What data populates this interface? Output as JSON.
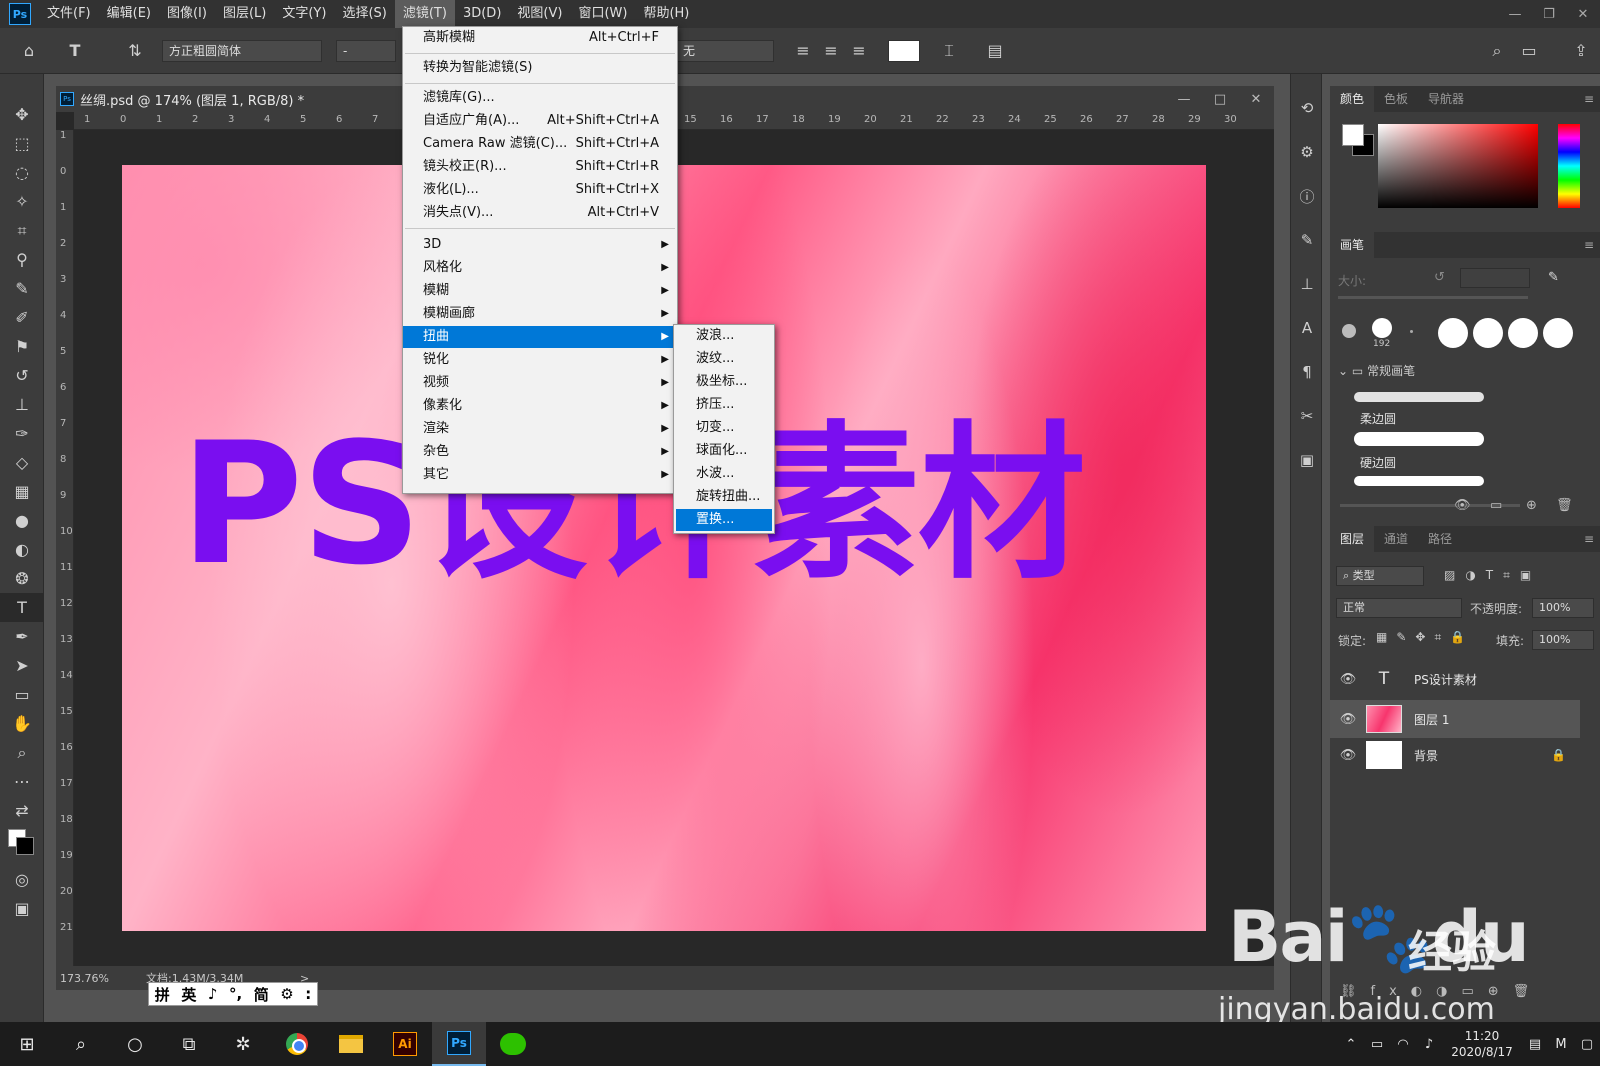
{
  "menubar": {
    "logo": "Ps",
    "items": [
      "文件(F)",
      "编辑(E)",
      "图像(I)",
      "图层(L)",
      "文字(Y)",
      "选择(S)",
      "滤镜(T)",
      "3D(D)",
      "视图(V)",
      "窗口(W)",
      "帮助(H)"
    ],
    "active_index": 6
  },
  "options": {
    "font_family": "方正粗圆简体",
    "font_style": "-",
    "antialias": "无",
    "color": "#ffffff"
  },
  "document": {
    "tab_title": "丝绸.psd @ 174% (图层 1, RGB/8) *",
    "canvas_text": "PS设计素材",
    "canvas_text_color": "#7a0ef0",
    "ruler_top": [
      "1",
      "0",
      "1",
      "2",
      "3",
      "4",
      "5",
      "6",
      "7",
      "15",
      "16",
      "17",
      "18",
      "19",
      "20",
      "21",
      "22",
      "23",
      "24",
      "25",
      "26",
      "27",
      "28",
      "29",
      "30"
    ],
    "ruler_left": [
      "1",
      "0",
      "1",
      "2",
      "3",
      "4",
      "5",
      "6",
      "7",
      "8",
      "9",
      "10",
      "11",
      "12",
      "13",
      "14",
      "15",
      "16",
      "17",
      "18",
      "19",
      "20",
      "21"
    ],
    "status_zoom": "173.76%",
    "status_doc": "文档:1.43M/3.34M",
    "status_arrow": ">"
  },
  "ime": {
    "items": [
      "拼",
      "英",
      "♪",
      "°,",
      "简",
      "⚙",
      ":"
    ]
  },
  "filter_menu": {
    "top_items": [
      {
        "label": "高斯模糊",
        "shortcut": "Alt+Ctrl+F"
      },
      {
        "label": "转换为智能滤镜(S)",
        "shortcut": ""
      }
    ],
    "mid_items": [
      {
        "label": "滤镜库(G)...",
        "shortcut": ""
      },
      {
        "label": "自适应广角(A)...",
        "shortcut": "Alt+Shift+Ctrl+A"
      },
      {
        "label": "Camera Raw 滤镜(C)...",
        "shortcut": "Shift+Ctrl+A"
      },
      {
        "label": "镜头校正(R)...",
        "shortcut": "Shift+Ctrl+R"
      },
      {
        "label": "液化(L)...",
        "shortcut": "Shift+Ctrl+X"
      },
      {
        "label": "消失点(V)...",
        "shortcut": "Alt+Ctrl+V"
      }
    ],
    "sub_items": [
      "3D",
      "风格化",
      "模糊",
      "模糊画廊",
      "扭曲",
      "锐化",
      "视频",
      "像素化",
      "渲染",
      "杂色",
      "其它"
    ],
    "sub_highlight": "扭曲"
  },
  "distort_submenu": {
    "items": [
      "波浪...",
      "波纹...",
      "极坐标...",
      "挤压...",
      "切变...",
      "球面化...",
      "水波...",
      "旋转扭曲...",
      "置换..."
    ],
    "highlight": "置换..."
  },
  "panels": {
    "color_tabs": [
      "颜色",
      "色板",
      "导航器"
    ],
    "brush_tab": "画笔",
    "brush_size_label": "大小:",
    "brush_preset_size": "192",
    "brush_group": "常规画笔",
    "brush_presets": [
      "柔边圆",
      "硬边圆"
    ],
    "layer_tabs": [
      "图层",
      "通道",
      "路径"
    ],
    "layer_filter": "类型",
    "blend_mode": "正常",
    "opacity_label": "不透明度:",
    "opacity_value": "100%",
    "lock_label": "锁定:",
    "fill_label": "填充:",
    "fill_value": "100%",
    "layers": [
      {
        "name": "PS设计素材",
        "type": "text",
        "selected": false
      },
      {
        "name": "图层 1",
        "type": "image",
        "selected": true
      },
      {
        "name": "背景",
        "type": "background",
        "selected": false
      }
    ]
  },
  "watermark": {
    "logo": "Bai",
    "logo2": "du",
    "cn": "经验",
    "url": "jingyan.baidu.com"
  },
  "taskbar": {
    "time": "11:20",
    "date": "2020/8/17",
    "apps": [
      "Ai",
      "Ps"
    ]
  }
}
